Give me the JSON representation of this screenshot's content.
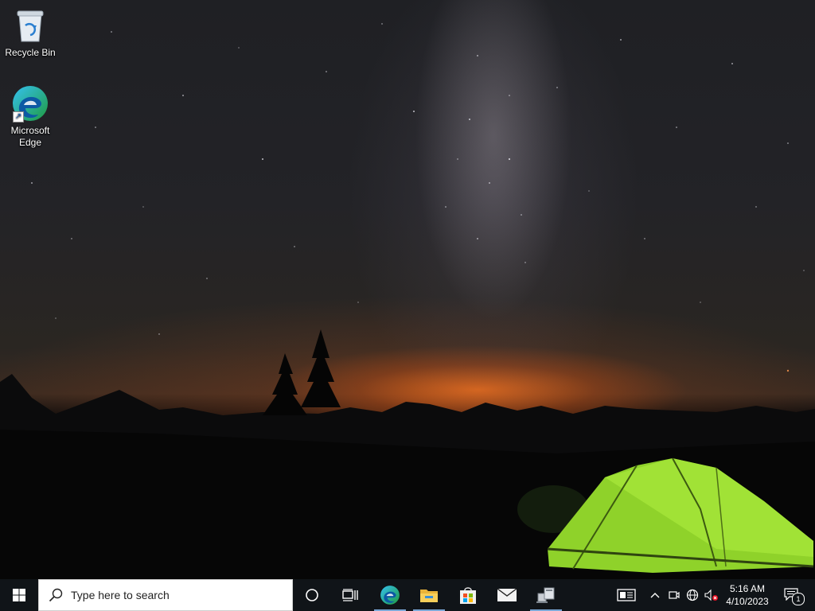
{
  "desktop": {
    "icons": [
      {
        "label": "Recycle Bin",
        "icon": "recycle-bin-icon"
      },
      {
        "label": "Microsoft Edge",
        "icon": "edge-icon"
      }
    ]
  },
  "taskbar": {
    "start_icon": "windows-logo-icon",
    "search": {
      "placeholder": "Type here to search",
      "icon": "search-icon"
    },
    "buttons": [
      {
        "name": "cortana",
        "icon": "cortana-circle-icon"
      },
      {
        "name": "task-view",
        "icon": "task-view-icon"
      },
      {
        "name": "edge",
        "icon": "edge-icon",
        "active": true
      },
      {
        "name": "file-explorer",
        "icon": "folder-icon",
        "active": true
      },
      {
        "name": "microsoft-store",
        "icon": "store-bag-icon"
      },
      {
        "name": "mail",
        "icon": "mail-icon"
      },
      {
        "name": "network-app",
        "icon": "computers-icon",
        "active": true
      }
    ],
    "tray": {
      "icons": [
        "news-icon",
        "chevron-up-icon",
        "camera-icon",
        "globe-network-icon",
        "volume-muted-icon"
      ],
      "time": "5:16 AM",
      "date": "4/10/2023",
      "notifications": {
        "icon": "notification-icon",
        "count": "1"
      }
    }
  },
  "colors": {
    "taskbar_bg": "#101418",
    "active_indicator": "#7aa7d6",
    "tent_green": "#9be02a",
    "horizon_glow": "#ec6e1e"
  }
}
